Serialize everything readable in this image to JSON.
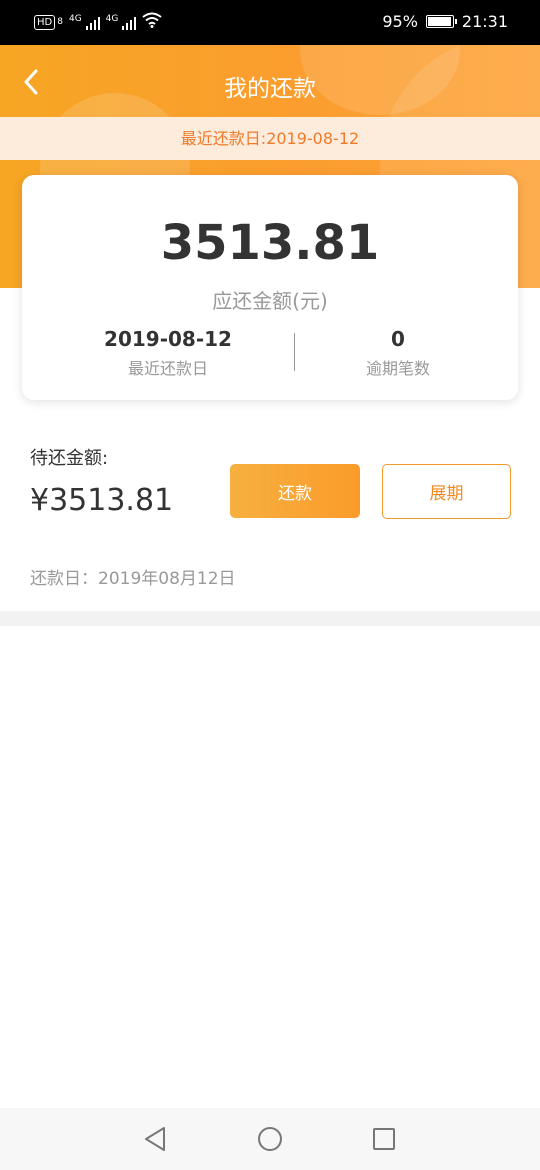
{
  "status_bar": {
    "network_badge": "HD",
    "network_badge_sub": "8",
    "signal1_label": "4G",
    "signal2_label": "4G",
    "battery_percent": "95%",
    "battery_level": 0.95,
    "time": "21:31"
  },
  "header": {
    "title": "我的还款",
    "back_icon": "chevron-left-icon"
  },
  "notice": {
    "text": "最近还款日:2019-08-12"
  },
  "summary": {
    "amount": "3513.81",
    "amount_caption": "应还金额(元)",
    "latest_date_value": "2019-08-12",
    "latest_date_label": "最近还款日",
    "overdue_count_value": "0",
    "overdue_count_label": "逾期笔数"
  },
  "detail": {
    "due_label": "待还金额:",
    "due_value": "¥3513.81",
    "repay_button": "还款",
    "extend_button": "展期",
    "repay_date": "还款日：2019年08月12日"
  },
  "colors": {
    "brand_orange": "#f6a623",
    "notice_text": "#f07a2a",
    "notice_bg": "#fdecdc"
  },
  "nav": {
    "back": "triangle-back-icon",
    "home": "circle-home-icon",
    "recents": "square-recents-icon"
  }
}
